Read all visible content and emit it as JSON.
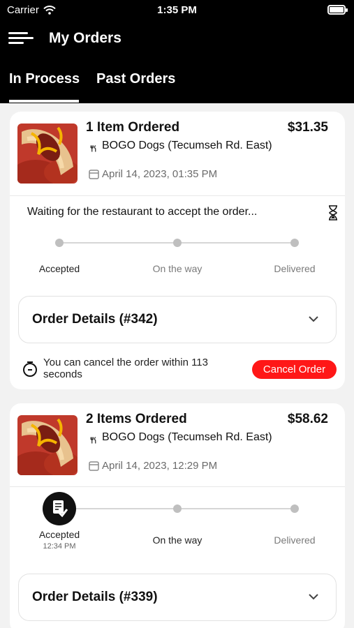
{
  "status_bar": {
    "carrier": "Carrier",
    "time": "1:35 PM"
  },
  "header": {
    "title": "My Orders"
  },
  "tabs": [
    {
      "label": "In Process",
      "active": true
    },
    {
      "label": "Past Orders",
      "active": false
    }
  ],
  "colors": {
    "accent": "#ff1717",
    "header_bg": "#000000",
    "card_bg": "#ffffff"
  },
  "orders": [
    {
      "items_label": "1 Item Ordered",
      "price": "$31.35",
      "restaurant": "BOGO Dogs (Tecumseh Rd. East)",
      "date": "April 14, 2023, 01:35 PM",
      "status_message": "Waiting for the restaurant to accept the order...",
      "steps": [
        {
          "label": "Accepted",
          "time": ""
        },
        {
          "label": "On the way",
          "time": ""
        },
        {
          "label": "Delivered",
          "time": ""
        }
      ],
      "details_title": "Order Details (#342)",
      "cancel_note": "You can cancel the order within 113 seconds",
      "cancel_button": "Cancel Order"
    },
    {
      "items_label": "2 Items Ordered",
      "price": "$58.62",
      "restaurant": "BOGO Dogs (Tecumseh Rd. East)",
      "date": "April 14, 2023, 12:29 PM",
      "steps": [
        {
          "label": "Accepted",
          "time": "12:34 PM"
        },
        {
          "label": "On the way",
          "time": ""
        },
        {
          "label": "Delivered",
          "time": ""
        }
      ],
      "details_title": "Order Details (#339)"
    }
  ]
}
